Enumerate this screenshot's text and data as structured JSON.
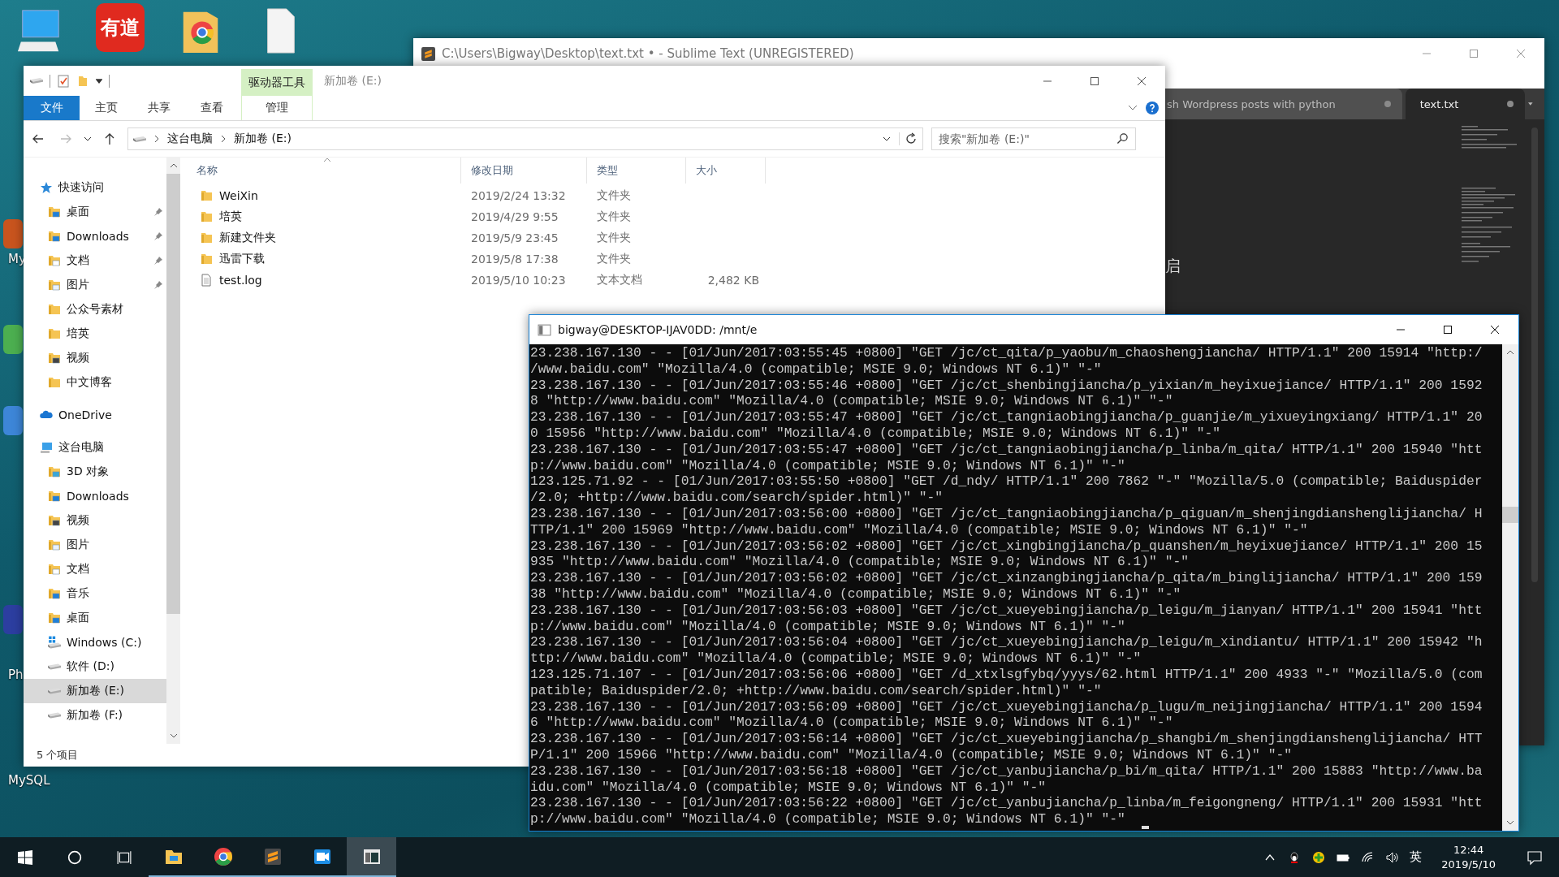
{
  "desktop": {
    "icons": [
      {
        "kind": "computer"
      },
      {
        "kind": "dictionary",
        "logo_text": "有道"
      },
      {
        "kind": "chrome-folder"
      },
      {
        "kind": "document"
      }
    ],
    "side_labels": [
      {
        "label": "My"
      },
      {
        "label": "Ph"
      },
      {
        "label": "MySQL"
      }
    ]
  },
  "sublime": {
    "title": "C:\\Users\\Bigway\\Desktop\\text.txt • - Sublime Text (UNREGISTERED)",
    "tabs": [
      {
        "label": "sh Wordpress posts with python",
        "selected": false,
        "modified": true
      },
      {
        "label": "text.txt",
        "selected": true,
        "modified": true
      }
    ],
    "editor_text": "启"
  },
  "explorer": {
    "title": "新加卷 (E:)",
    "context_tab": "驱动器工具",
    "ribbon_tabs": [
      {
        "label": "文件",
        "kind": "file",
        "selected": false
      },
      {
        "label": "主页",
        "kind": "tab",
        "selected": false
      },
      {
        "label": "共享",
        "kind": "tab",
        "selected": false
      },
      {
        "label": "查看",
        "kind": "tab",
        "selected": false
      },
      {
        "label": "管理",
        "kind": "context",
        "selected": false
      }
    ],
    "breadcrumb": [
      "这台电脑",
      "新加卷 (E:)"
    ],
    "search": {
      "placeholder": "搜索\"新加卷 (E:)\""
    },
    "columns": [
      "名称",
      "修改日期",
      "类型",
      "大小"
    ],
    "files": [
      {
        "name": "WeiXin",
        "modified": "2019/2/24 13:32",
        "type": "文件夹",
        "kind": "folder"
      },
      {
        "name": "培英",
        "modified": "2019/4/29 9:55",
        "type": "文件夹",
        "kind": "folder"
      },
      {
        "name": "新建文件夹",
        "modified": "2019/5/9 23:45",
        "type": "文件夹",
        "kind": "folder"
      },
      {
        "name": "迅雷下载",
        "modified": "2019/5/8 17:38",
        "type": "文件夹",
        "kind": "folder"
      },
      {
        "name": "test.log",
        "modified": "2019/5/10 10:23",
        "type": "文本文档",
        "size": "2,482 KB",
        "kind": "file"
      }
    ],
    "navigation": [
      {
        "label": "快速访问",
        "kind": "star",
        "selected": false,
        "children": [
          {
            "label": "桌面",
            "kind": "desktop",
            "pinned": true,
            "selected": false
          },
          {
            "label": "Downloads",
            "kind": "download",
            "pinned": true,
            "selected": false
          },
          {
            "label": "文档",
            "kind": "document",
            "pinned": true,
            "selected": false
          },
          {
            "label": "图片",
            "kind": "picture",
            "pinned": true,
            "selected": false
          },
          {
            "label": "公众号素材",
            "kind": "folder",
            "pinned": false,
            "selected": false
          },
          {
            "label": "培英",
            "kind": "folder",
            "pinned": false,
            "selected": false
          },
          {
            "label": "视频",
            "kind": "video",
            "pinned": false,
            "selected": false
          },
          {
            "label": "中文博客",
            "kind": "folder",
            "pinned": false,
            "selected": false
          }
        ]
      },
      {
        "label": "OneDrive",
        "kind": "cloud",
        "selected": false
      },
      {
        "label": "这台电脑",
        "kind": "pc",
        "selected": false,
        "children": [
          {
            "label": "3D 对象",
            "kind": "objects",
            "pinned": false,
            "selected": false
          },
          {
            "label": "Downloads",
            "kind": "download",
            "pinned": false,
            "selected": false
          },
          {
            "label": "视频",
            "kind": "video",
            "pinned": false,
            "selected": false
          },
          {
            "label": "图片",
            "kind": "picture",
            "pinned": false,
            "selected": false
          },
          {
            "label": "文档",
            "kind": "document",
            "pinned": false,
            "selected": false
          },
          {
            "label": "音乐",
            "kind": "music",
            "pinned": false,
            "selected": false
          },
          {
            "label": "桌面",
            "kind": "desktop",
            "pinned": false,
            "selected": false
          },
          {
            "label": "Windows (C:)",
            "kind": "system",
            "pinned": false,
            "selected": false
          },
          {
            "label": "软件 (D:)",
            "kind": "drive",
            "pinned": false,
            "selected": false
          },
          {
            "label": "新加卷 (E:)",
            "kind": "drive",
            "pinned": false,
            "selected": true
          },
          {
            "label": "新加卷 (F:)",
            "kind": "drive",
            "pinned": false,
            "selected": false
          }
        ]
      }
    ],
    "status_bar": "5 个项目"
  },
  "terminal": {
    "title": "bigway@DESKTOP-IJAV0DD: /mnt/e",
    "lines": [
      "23.238.167.130 - - [01/Jun/2017:03:55:45 +0800] \"GET /jc/ct_qita/p_yaobu/m_chaoshengjiancha/ HTTP/1.1\" 200 15914 \"http:/",
      "/www.baidu.com\" \"Mozilla/4.0 (compatible; MSIE 9.0; Windows NT 6.1)\" \"-\"",
      "23.238.167.130 - - [01/Jun/2017:03:55:46 +0800] \"GET /jc/ct_shenbingjiancha/p_yixian/m_heyixuejiance/ HTTP/1.1\" 200 1592",
      "8 \"http://www.baidu.com\" \"Mozilla/4.0 (compatible; MSIE 9.0; Windows NT 6.1)\" \"-\"",
      "23.238.167.130 - - [01/Jun/2017:03:55:47 +0800] \"GET /jc/ct_tangniaobingjiancha/p_guanjie/m_yixueyingxiang/ HTTP/1.1\" 20",
      "0 15956 \"http://www.baidu.com\" \"Mozilla/4.0 (compatible; MSIE 9.0; Windows NT 6.1)\" \"-\"",
      "23.238.167.130 - - [01/Jun/2017:03:55:47 +0800] \"GET /jc/ct_tangniaobingjiancha/p_linba/m_qita/ HTTP/1.1\" 200 15940 \"htt",
      "p://www.baidu.com\" \"Mozilla/4.0 (compatible; MSIE 9.0; Windows NT 6.1)\" \"-\"",
      "123.125.71.92 - - [01/Jun/2017:03:55:50 +0800] \"GET /d_ndy/ HTTP/1.1\" 200 7862 \"-\" \"Mozilla/5.0 (compatible; Baiduspider",
      "/2.0; +http://www.baidu.com/search/spider.html)\" \"-\"",
      "23.238.167.130 - - [01/Jun/2017:03:56:00 +0800] \"GET /jc/ct_tangniaobingjiancha/p_qiguan/m_shenjingdianshenglijiancha/ H",
      "TTP/1.1\" 200 15969 \"http://www.baidu.com\" \"Mozilla/4.0 (compatible; MSIE 9.0; Windows NT 6.1)\" \"-\"",
      "23.238.167.130 - - [01/Jun/2017:03:56:02 +0800] \"GET /jc/ct_xingbingjiancha/p_quanshen/m_heyixuejiance/ HTTP/1.1\" 200 15",
      "935 \"http://www.baidu.com\" \"Mozilla/4.0 (compatible; MSIE 9.0; Windows NT 6.1)\" \"-\"",
      "23.238.167.130 - - [01/Jun/2017:03:56:02 +0800] \"GET /jc/ct_xinzangbingjiancha/p_qita/m_binglijiancha/ HTTP/1.1\" 200 159",
      "38 \"http://www.baidu.com\" \"Mozilla/4.0 (compatible; MSIE 9.0; Windows NT 6.1)\" \"-\"",
      "23.238.167.130 - - [01/Jun/2017:03:56:03 +0800] \"GET /jc/ct_xueyebingjiancha/p_leigu/m_jianyan/ HTTP/1.1\" 200 15941 \"htt",
      "p://www.baidu.com\" \"Mozilla/4.0 (compatible; MSIE 9.0; Windows NT 6.1)\" \"-\"",
      "23.238.167.130 - - [01/Jun/2017:03:56:04 +0800] \"GET /jc/ct_xueyebingjiancha/p_leigu/m_xindiantu/ HTTP/1.1\" 200 15942 \"h",
      "ttp://www.baidu.com\" \"Mozilla/4.0 (compatible; MSIE 9.0; Windows NT 6.1)\" \"-\"",
      "123.125.71.107 - - [01/Jun/2017:03:56:06 +0800] \"GET /d_xtxlsgfybq/yyys/62.html HTTP/1.1\" 200 4933 \"-\" \"Mozilla/5.0 (com",
      "patible; Baiduspider/2.0; +http://www.baidu.com/search/spider.html)\" \"-\"",
      "23.238.167.130 - - [01/Jun/2017:03:56:09 +0800] \"GET /jc/ct_xueyebingjiancha/p_lugu/m_neijingjiancha/ HTTP/1.1\" 200 1594",
      "6 \"http://www.baidu.com\" \"Mozilla/4.0 (compatible; MSIE 9.0; Windows NT 6.1)\" \"-\"",
      "23.238.167.130 - - [01/Jun/2017:03:56:14 +0800] \"GET /jc/ct_xueyebingjiancha/p_shangbi/m_shenjingdianshenglijiancha/ HTT",
      "P/1.1\" 200 15966 \"http://www.baidu.com\" \"Mozilla/4.0 (compatible; MSIE 9.0; Windows NT 6.1)\" \"-\"",
      "23.238.167.130 - - [01/Jun/2017:03:56:18 +0800] \"GET /jc/ct_yanbujiancha/p_bi/m_qita/ HTTP/1.1\" 200 15883 \"http://www.ba",
      "idu.com\" \"Mozilla/4.0 (compatible; MSIE 9.0; Windows NT 6.1)\" \"-\"",
      "23.238.167.130 - - [01/Jun/2017:03:56:22 +0800] \"GET /jc/ct_yanbujiancha/p_linba/m_feigongneng/ HTTP/1.1\" 200 15931 \"htt",
      "p://www.baidu.com\" \"Mozilla/4.0 (compatible; MSIE 9.0; Windows NT 6.1)\" \"-\""
    ]
  },
  "taskbar": {
    "apps": [
      {
        "kind": "start",
        "running": false,
        "selected": false
      },
      {
        "kind": "search",
        "running": false,
        "selected": false
      },
      {
        "kind": "task-view",
        "running": false,
        "selected": false
      },
      {
        "kind": "explorer",
        "running": true,
        "selected": false
      },
      {
        "kind": "chrome",
        "running": true,
        "selected": false
      },
      {
        "kind": "sublime",
        "running": true,
        "selected": false
      },
      {
        "kind": "video",
        "running": true,
        "selected": false
      },
      {
        "kind": "terminal",
        "running": true,
        "selected": true
      }
    ],
    "tray": [
      {
        "kind": "chevron"
      },
      {
        "kind": "penguin"
      },
      {
        "kind": "shield"
      },
      {
        "kind": "battery"
      },
      {
        "kind": "wifi"
      },
      {
        "kind": "volume"
      }
    ],
    "ime": "英",
    "time": "12:44",
    "date": "2019/5/10"
  }
}
